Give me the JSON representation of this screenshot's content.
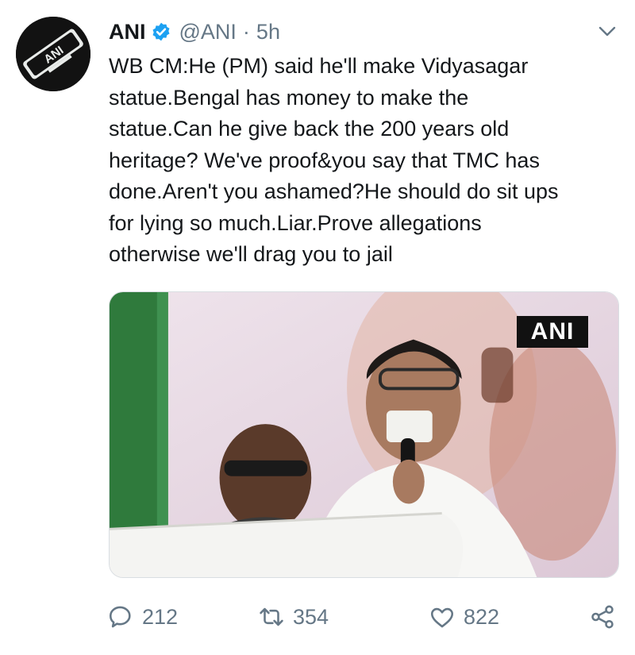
{
  "tweet": {
    "author": {
      "name": "ANI",
      "handle": "@ANI",
      "avatar_text": "ANI",
      "verified": true
    },
    "separator": "·",
    "time": "5h",
    "text_lines": [
      "WB CM:He (PM) said he'll make Vidyasagar",
      "statue.Bengal has money to make the",
      "statue.Can he give back the 200 years old",
      "heritage? We've proof&you say that TMC has",
      "done.Aren't you ashamed?He should do sit ups",
      "for lying so much.Liar.Prove allegations",
      "otherwise we'll drag you to jail"
    ],
    "media": {
      "watermark": "ANI"
    },
    "actions": {
      "reply_count": "212",
      "retweet_count": "354",
      "like_count": "822"
    }
  },
  "colors": {
    "text": "#14171a",
    "secondary": "#657786",
    "verified": "#1da1f2"
  },
  "icons": [
    "more-caret-icon",
    "verified-badge-icon",
    "reply-icon",
    "retweet-icon",
    "like-icon",
    "share-icon"
  ]
}
